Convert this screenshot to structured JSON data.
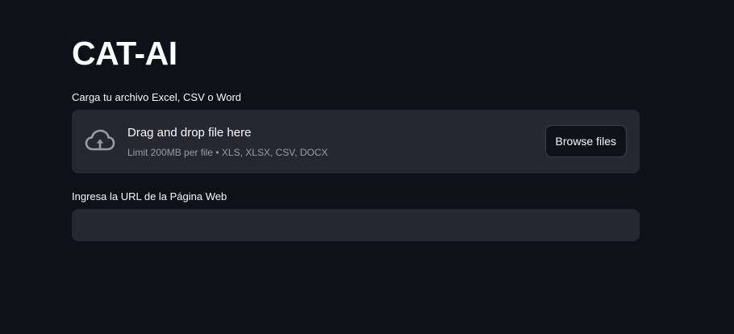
{
  "app": {
    "title": "CAT-AI"
  },
  "uploader": {
    "label": "Carga tu archivo Excel, CSV o Word",
    "drop_text": "Drag and drop file here",
    "limit_text": "Limit 200MB per file • XLS, XLSX, CSV, DOCX",
    "browse_label": "Browse files",
    "icon": "cloud-upload-icon"
  },
  "url_field": {
    "label": "Ingresa la URL de la Página Web",
    "value": "",
    "placeholder": ""
  },
  "colors": {
    "background": "#0e1117",
    "surface": "#262730",
    "text": "#fafafa",
    "muted_text": "#9a9ca3",
    "border": "#3d3f48"
  }
}
